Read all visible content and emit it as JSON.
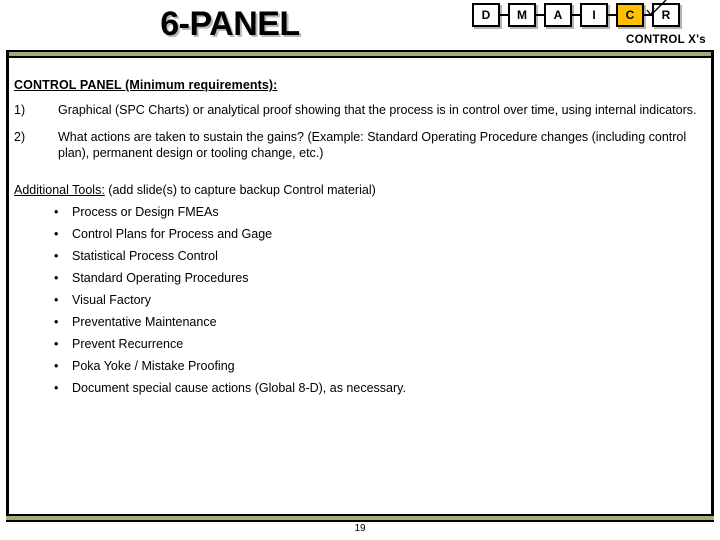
{
  "slide": {
    "title": "6-PANEL",
    "page_number": "19",
    "accent_color": "#A8A878",
    "highlight_color": "#FFC000"
  },
  "roadmap": {
    "caption": "CONTROL X's",
    "active_index": 4,
    "steps": [
      {
        "label": "D"
      },
      {
        "label": "M"
      },
      {
        "label": "A"
      },
      {
        "label": "I"
      },
      {
        "label": "C"
      },
      {
        "label": "R"
      }
    ]
  },
  "main": {
    "heading": "CONTROL PANEL  (Minimum requirements):",
    "numbered_items": [
      {
        "number": "1)",
        "text": "Graphical (SPC Charts) or analytical proof showing that the process is in control over time, using internal indicators."
      },
      {
        "number": "2)",
        "text": "What actions are taken to sustain the gains?  (Example: Standard Operating Procedure changes (including control plan), permanent design or tooling change, etc.)"
      }
    ],
    "tools": {
      "label": "Additional Tools:",
      "note": " (add slide(s) to capture backup Control material)",
      "bullet_char": "•",
      "items": [
        "Process or Design FMEAs",
        "Control Plans for Process and Gage",
        "Statistical Process Control",
        "Standard Operating Procedures",
        "Visual Factory",
        "Preventative Maintenance",
        "Prevent Recurrence",
        "Poka Yoke / Mistake Proofing",
        "Document special cause actions (Global 8-D), as necessary."
      ]
    }
  }
}
